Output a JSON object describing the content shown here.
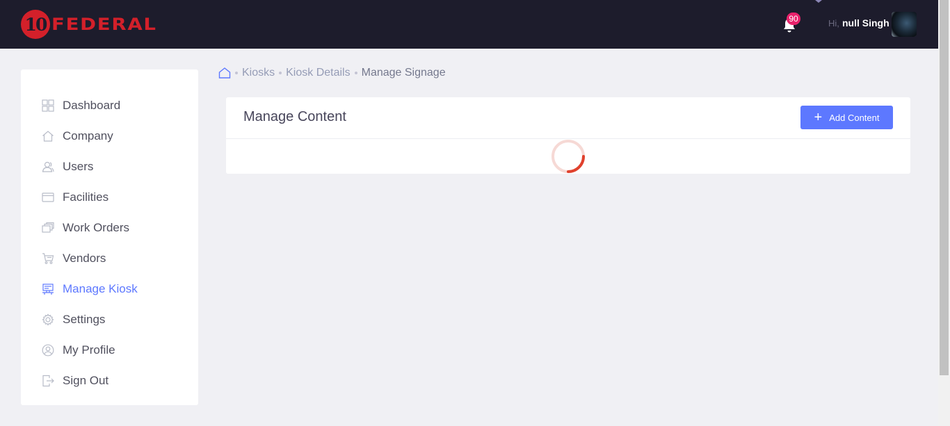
{
  "header": {
    "logo_number": "10",
    "logo_text": "FEDERAL",
    "notification_count": "90",
    "greeting": "Hi,",
    "username": "null Singh"
  },
  "sidebar": {
    "items": [
      {
        "label": "Dashboard",
        "icon": "dashboard-icon"
      },
      {
        "label": "Company",
        "icon": "home-icon"
      },
      {
        "label": "Users",
        "icon": "users-icon"
      },
      {
        "label": "Facilities",
        "icon": "facilities-icon"
      },
      {
        "label": "Work Orders",
        "icon": "work-orders-icon"
      },
      {
        "label": "Vendors",
        "icon": "cart-icon"
      },
      {
        "label": "Manage Kiosk",
        "icon": "kiosk-icon",
        "active": true
      },
      {
        "label": "Settings",
        "icon": "gear-icon"
      },
      {
        "label": "My Profile",
        "icon": "profile-icon"
      },
      {
        "label": "Sign Out",
        "icon": "sign-out-icon"
      }
    ]
  },
  "breadcrumb": {
    "items": [
      "Kiosks",
      "Kiosk Details"
    ],
    "current": "Manage Signage"
  },
  "content": {
    "title": "Manage Content",
    "add_button": "Add Content",
    "loading": true
  },
  "colors": {
    "topbar": "#1d1c2c",
    "brand_red": "#d3202a",
    "accent": "#5d78ff",
    "badge": "#e8226b",
    "spinner": "#e0412d"
  }
}
